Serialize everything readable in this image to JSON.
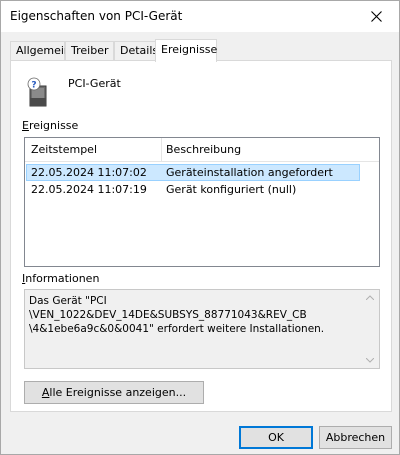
{
  "window": {
    "title": "Eigenschaften von PCI-Gerät"
  },
  "tabs": [
    {
      "label": "Allgemein"
    },
    {
      "label": "Treiber"
    },
    {
      "label": "Details"
    },
    {
      "label": "Ereignisse"
    }
  ],
  "device": {
    "name": "PCI-Gerät",
    "icon": "unknown-device-icon"
  },
  "events": {
    "group_label_first": "E",
    "group_label_rest": "reignisse",
    "columns": [
      "Zeitstempel",
      "Beschreibung"
    ],
    "rows": [
      {
        "timestamp": "22.05.2024 11:07:02",
        "description": "Geräteinstallation angefordert"
      },
      {
        "timestamp": "22.05.2024 11:07:19",
        "description": "Gerät konfiguriert (null)"
      }
    ]
  },
  "info": {
    "group_label_first": "I",
    "group_label_rest": "nformationen",
    "text": "Das Gerät \"PCI\n\\VEN_1022&DEV_14DE&SUBSYS_88771043&REV_CB\n\\4&1ebe6a9c&0&0041\" erfordert weitere Installationen."
  },
  "buttons": {
    "show_all_first": "A",
    "show_all_rest": "lle Ereignisse anzeigen...",
    "ok": "OK",
    "cancel": "Abbrechen"
  },
  "colors": {
    "selection": "#cce8ff",
    "default_button_border": "#0078d7"
  }
}
